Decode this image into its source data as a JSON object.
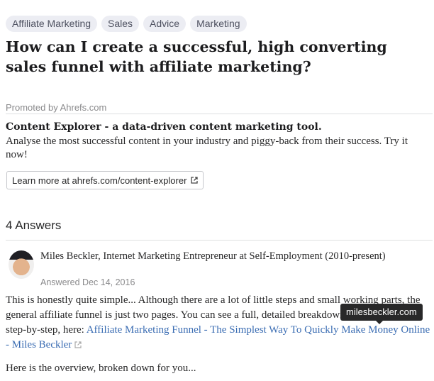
{
  "tags": [
    "Affiliate Marketing",
    "Sales",
    "Advice",
    "Marketing"
  ],
  "question": {
    "title": "How can I create a successful, high converting sales funnel with affiliate marketing?"
  },
  "ad": {
    "promoted_by": "Promoted by Ahrefs.com",
    "headline": "Content Explorer - a data-driven content marketing tool.",
    "body": "Analyse the most successful content in your industry and piggy-back from their success. Try it now!",
    "cta_label": "Learn more at ahrefs.com/content-explorer",
    "cta_icon": "external-link-icon"
  },
  "answers": {
    "count_label": "4 Answers",
    "items": [
      {
        "author": "Miles Beckler, Internet Marketing Entrepreneur at Self-Employment (2010-present)",
        "answered": "Answered Dec 14, 2016",
        "body_prefix": "This is honestly quite simple... Although there are a lot of little steps and small working parts, the general affiliate funnel is just two pages. You can see a full, detailed breakdown of this process, step-by-step, here: ",
        "link_text": "Affiliate Marketing Funnel - The Simplest Way To Quickly Make Money Online - Miles Beckler",
        "link_tooltip": "milesbeckler.com",
        "overview": "Here is the overview, broken down for you..."
      }
    ]
  },
  "colors": {
    "link": "#3b6db3",
    "tag_bg": "#ecedf3",
    "tooltip_bg": "#282829"
  }
}
